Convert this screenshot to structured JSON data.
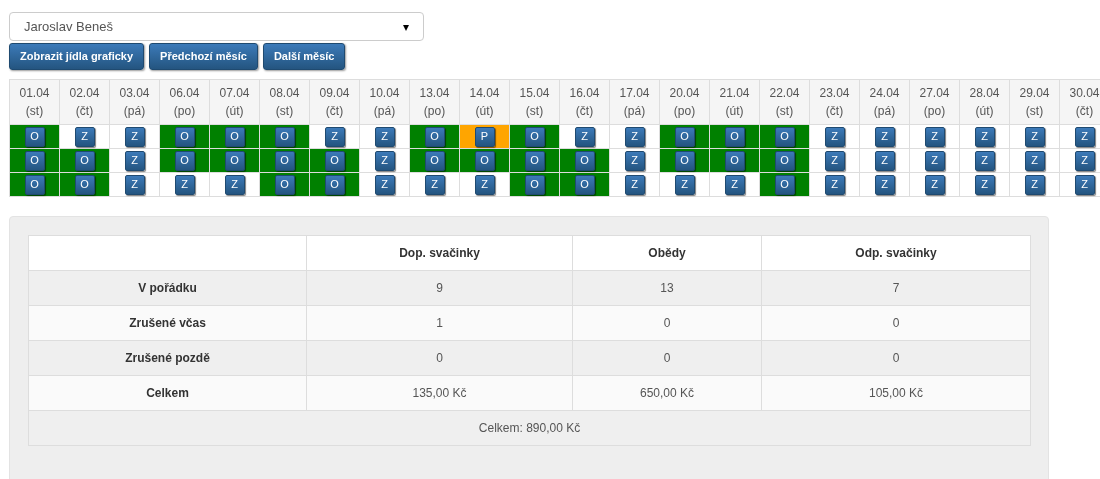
{
  "person_select": {
    "value": "Jaroslav Beneš",
    "arrow": "▾"
  },
  "buttons": [
    "Zobrazit jídla graficky",
    "Předchozí měsíc",
    "Další měsíc"
  ],
  "days": [
    {
      "date": "01.04",
      "weekday": "(st)",
      "meals": [
        {
          "letter": "O",
          "color": "#008000"
        },
        {
          "letter": "O",
          "color": "#008000"
        },
        {
          "letter": "O",
          "color": "#008000"
        }
      ]
    },
    {
      "date": "02.04",
      "weekday": "(čt)",
      "meals": [
        {
          "letter": "Z",
          "color": "#ffffff"
        },
        {
          "letter": "O",
          "color": "#008000"
        },
        {
          "letter": "O",
          "color": "#008000"
        }
      ]
    },
    {
      "date": "03.04",
      "weekday": "(pá)",
      "meals": [
        {
          "letter": "Z",
          "color": "#ffffff"
        },
        {
          "letter": "Z",
          "color": "#ffffff"
        },
        {
          "letter": "Z",
          "color": "#ffffff"
        }
      ]
    },
    {
      "date": "06.04",
      "weekday": "(po)",
      "meals": [
        {
          "letter": "O",
          "color": "#008000"
        },
        {
          "letter": "O",
          "color": "#008000"
        },
        {
          "letter": "Z",
          "color": "#ffffff"
        }
      ]
    },
    {
      "date": "07.04",
      "weekday": "(út)",
      "meals": [
        {
          "letter": "O",
          "color": "#008000"
        },
        {
          "letter": "O",
          "color": "#008000"
        },
        {
          "letter": "Z",
          "color": "#ffffff"
        }
      ]
    },
    {
      "date": "08.04",
      "weekday": "(st)",
      "meals": [
        {
          "letter": "O",
          "color": "#008000"
        },
        {
          "letter": "O",
          "color": "#008000"
        },
        {
          "letter": "O",
          "color": "#008000"
        }
      ]
    },
    {
      "date": "09.04",
      "weekday": "(čt)",
      "meals": [
        {
          "letter": "Z",
          "color": "#ffffff"
        },
        {
          "letter": "O",
          "color": "#008000"
        },
        {
          "letter": "O",
          "color": "#008000"
        }
      ]
    },
    {
      "date": "10.04",
      "weekday": "(pá)",
      "meals": [
        {
          "letter": "Z",
          "color": "#ffffff"
        },
        {
          "letter": "Z",
          "color": "#ffffff"
        },
        {
          "letter": "Z",
          "color": "#ffffff"
        }
      ]
    },
    {
      "date": "13.04",
      "weekday": "(po)",
      "meals": [
        {
          "letter": "O",
          "color": "#008000"
        },
        {
          "letter": "O",
          "color": "#008000"
        },
        {
          "letter": "Z",
          "color": "#ffffff"
        }
      ]
    },
    {
      "date": "14.04",
      "weekday": "(út)",
      "meals": [
        {
          "letter": "P",
          "color": "#ffa500"
        },
        {
          "letter": "O",
          "color": "#008000"
        },
        {
          "letter": "Z",
          "color": "#ffffff"
        }
      ]
    },
    {
      "date": "15.04",
      "weekday": "(st)",
      "meals": [
        {
          "letter": "O",
          "color": "#008000"
        },
        {
          "letter": "O",
          "color": "#008000"
        },
        {
          "letter": "O",
          "color": "#008000"
        }
      ]
    },
    {
      "date": "16.04",
      "weekday": "(čt)",
      "meals": [
        {
          "letter": "Z",
          "color": "#ffffff"
        },
        {
          "letter": "O",
          "color": "#008000"
        },
        {
          "letter": "O",
          "color": "#008000"
        }
      ]
    },
    {
      "date": "17.04",
      "weekday": "(pá)",
      "meals": [
        {
          "letter": "Z",
          "color": "#ffffff"
        },
        {
          "letter": "Z",
          "color": "#ffffff"
        },
        {
          "letter": "Z",
          "color": "#ffffff"
        }
      ]
    },
    {
      "date": "20.04",
      "weekday": "(po)",
      "meals": [
        {
          "letter": "O",
          "color": "#008000"
        },
        {
          "letter": "O",
          "color": "#008000"
        },
        {
          "letter": "Z",
          "color": "#ffffff"
        }
      ]
    },
    {
      "date": "21.04",
      "weekday": "(út)",
      "meals": [
        {
          "letter": "O",
          "color": "#008000"
        },
        {
          "letter": "O",
          "color": "#008000"
        },
        {
          "letter": "Z",
          "color": "#ffffff"
        }
      ]
    },
    {
      "date": "22.04",
      "weekday": "(st)",
      "meals": [
        {
          "letter": "O",
          "color": "#008000"
        },
        {
          "letter": "O",
          "color": "#008000"
        },
        {
          "letter": "O",
          "color": "#008000"
        }
      ]
    },
    {
      "date": "23.04",
      "weekday": "(čt)",
      "meals": [
        {
          "letter": "Z",
          "color": "#ffffff"
        },
        {
          "letter": "Z",
          "color": "#ffffff"
        },
        {
          "letter": "Z",
          "color": "#ffffff"
        }
      ]
    },
    {
      "date": "24.04",
      "weekday": "(pá)",
      "meals": [
        {
          "letter": "Z",
          "color": "#ffffff"
        },
        {
          "letter": "Z",
          "color": "#ffffff"
        },
        {
          "letter": "Z",
          "color": "#ffffff"
        }
      ]
    },
    {
      "date": "27.04",
      "weekday": "(po)",
      "meals": [
        {
          "letter": "Z",
          "color": "#ffffff"
        },
        {
          "letter": "Z",
          "color": "#ffffff"
        },
        {
          "letter": "Z",
          "color": "#ffffff"
        }
      ]
    },
    {
      "date": "28.04",
      "weekday": "(út)",
      "meals": [
        {
          "letter": "Z",
          "color": "#ffffff"
        },
        {
          "letter": "Z",
          "color": "#ffffff"
        },
        {
          "letter": "Z",
          "color": "#ffffff"
        }
      ]
    },
    {
      "date": "29.04",
      "weekday": "(st)",
      "meals": [
        {
          "letter": "Z",
          "color": "#ffffff"
        },
        {
          "letter": "Z",
          "color": "#ffffff"
        },
        {
          "letter": "Z",
          "color": "#ffffff"
        }
      ]
    },
    {
      "date": "30.04",
      "weekday": "(čt)",
      "meals": [
        {
          "letter": "Z",
          "color": "#ffffff"
        },
        {
          "letter": "Z",
          "color": "#ffffff"
        },
        {
          "letter": "Z",
          "color": "#ffffff"
        }
      ]
    }
  ],
  "summary": {
    "columns": [
      "Dop. svačinky",
      "Obědy",
      "Odp. svačinky"
    ],
    "rows": [
      {
        "label": "V pořádku",
        "cells": [
          "9",
          "13",
          "7"
        ]
      },
      {
        "label": "Zrušené včas",
        "cells": [
          "1",
          "0",
          "0"
        ]
      },
      {
        "label": "Zrušené pozdě",
        "cells": [
          "0",
          "0",
          "0"
        ]
      },
      {
        "label": "Celkem",
        "cells": [
          "135,00 Kč",
          "650,00 Kč",
          "105,00 Kč"
        ]
      }
    ],
    "total": "Celkem: 890,00 Kč"
  }
}
